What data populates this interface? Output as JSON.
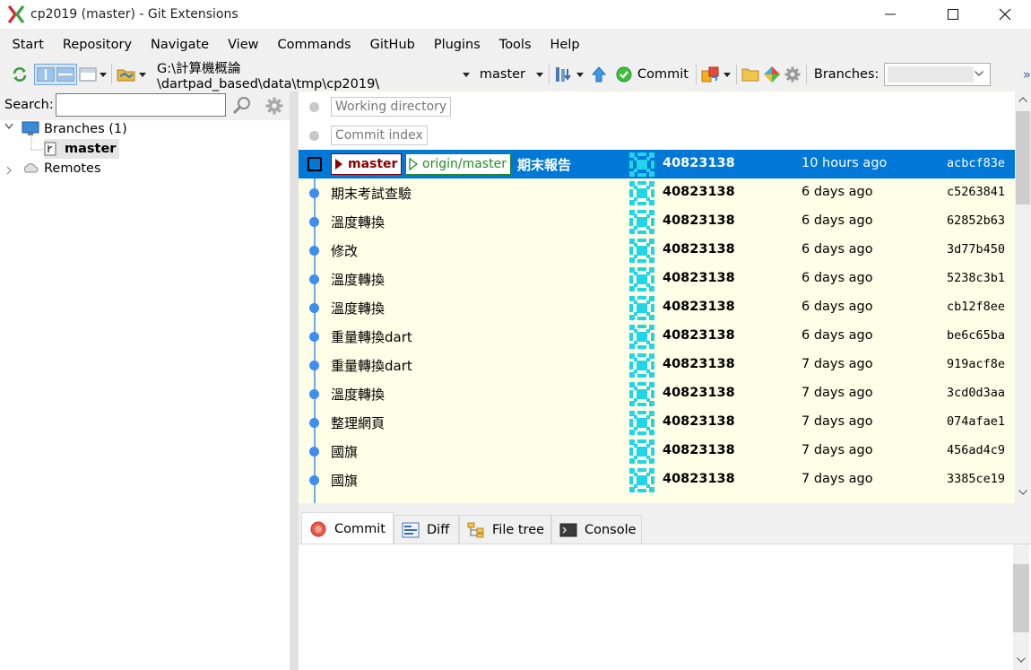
{
  "window": {
    "title": "cp2019 (master) - Git Extensions"
  },
  "menu": [
    "Start",
    "Repository",
    "Navigate",
    "View",
    "Commands",
    "GitHub",
    "Plugins",
    "Tools",
    "Help"
  ],
  "toolbar": {
    "path": "G:\\計算機概論\\dartpad_based\\data\\tmp\\cp2019\\",
    "branch": "master",
    "commit_label": "Commit",
    "branches_label": "Branches:",
    "branches_value": "",
    "overflow": "»"
  },
  "left_panel": {
    "search_label": "Search:",
    "search_value": "",
    "tree": {
      "branches": "Branches (1)",
      "master": "master",
      "remotes": "Remotes"
    }
  },
  "grid": {
    "pseudo_rows": [
      "Working directory",
      "Commit index"
    ],
    "selected": {
      "local_ref": "master",
      "remote_ref": "origin/master",
      "message": "期末報告",
      "author": "40823138",
      "date": "10 hours ago",
      "hash": "acbcf83e"
    },
    "commits": [
      {
        "message": "期末考試查驗",
        "author": "40823138",
        "date": "6 days ago",
        "hash": "c5263841"
      },
      {
        "message": "溫度轉換",
        "author": "40823138",
        "date": "6 days ago",
        "hash": "62852b63"
      },
      {
        "message": "修改",
        "author": "40823138",
        "date": "6 days ago",
        "hash": "3d77b450"
      },
      {
        "message": "溫度轉換",
        "author": "40823138",
        "date": "6 days ago",
        "hash": "5238c3b1"
      },
      {
        "message": "溫度轉換",
        "author": "40823138",
        "date": "6 days ago",
        "hash": "cb12f8ee"
      },
      {
        "message": "重量轉換dart",
        "author": "40823138",
        "date": "6 days ago",
        "hash": "be6c65ba"
      },
      {
        "message": "重量轉換dart",
        "author": "40823138",
        "date": "7 days ago",
        "hash": "919acf8e"
      },
      {
        "message": "溫度轉換",
        "author": "40823138",
        "date": "7 days ago",
        "hash": "3cd0d3aa"
      },
      {
        "message": "整理網頁",
        "author": "40823138",
        "date": "7 days ago",
        "hash": "074afae1"
      },
      {
        "message": "國旗",
        "author": "40823138",
        "date": "7 days ago",
        "hash": "456ad4c9"
      },
      {
        "message": "國旗",
        "author": "40823138",
        "date": "7 days ago",
        "hash": "3385ce19"
      }
    ]
  },
  "tabs": [
    "Commit",
    "Diff",
    "File tree",
    "Console"
  ],
  "colors": {
    "selection": "#0078d7",
    "grid_bg": "#fffee6",
    "graph": "#3d8ef1",
    "local_ref": "#8b0000",
    "remote_ref": "#228b22",
    "avatar": "#1ed6e8"
  }
}
